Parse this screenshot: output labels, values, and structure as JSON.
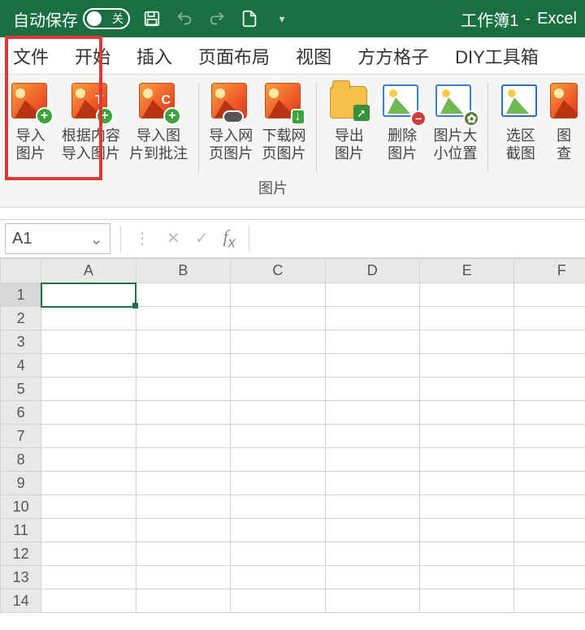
{
  "titlebar": {
    "autosave_label": "自动保存",
    "autosave_state": "关",
    "doc_title": "工作簿1",
    "app_name": "Excel"
  },
  "tabs": {
    "file": "文件",
    "home": "开始",
    "insert": "插入",
    "layout": "页面布局",
    "view": "视图",
    "ffgz": "方方格子",
    "diy": "DIY工具箱"
  },
  "ribbon": {
    "group_label": "图片",
    "btn_import_image_l1": "导入",
    "btn_import_image_l2": "图片",
    "btn_content_import_l1": "根据内容",
    "btn_content_import_l2": "导入图片",
    "btn_import_comment_l1": "导入图",
    "btn_import_comment_l2": "片到批注",
    "btn_import_web_l1": "导入网",
    "btn_import_web_l2": "页图片",
    "btn_download_web_l1": "下载网",
    "btn_download_web_l2": "页图片",
    "btn_export_l1": "导出",
    "btn_export_l2": "图片",
    "btn_delete_l1": "删除",
    "btn_delete_l2": "图片",
    "btn_size_l1": "图片大",
    "btn_size_l2": "小位置",
    "btn_selshot_l1": "选区",
    "btn_selshot_l2": "截图",
    "btn_view_l1": "图",
    "btn_view_l2": "查"
  },
  "namebox": {
    "value": "A1"
  },
  "grid": {
    "columns": [
      "A",
      "B",
      "C",
      "D",
      "E",
      "F"
    ],
    "rows": [
      "1",
      "2",
      "3",
      "4",
      "5",
      "6",
      "7",
      "8",
      "9",
      "10",
      "11",
      "12",
      "13",
      "14"
    ]
  }
}
